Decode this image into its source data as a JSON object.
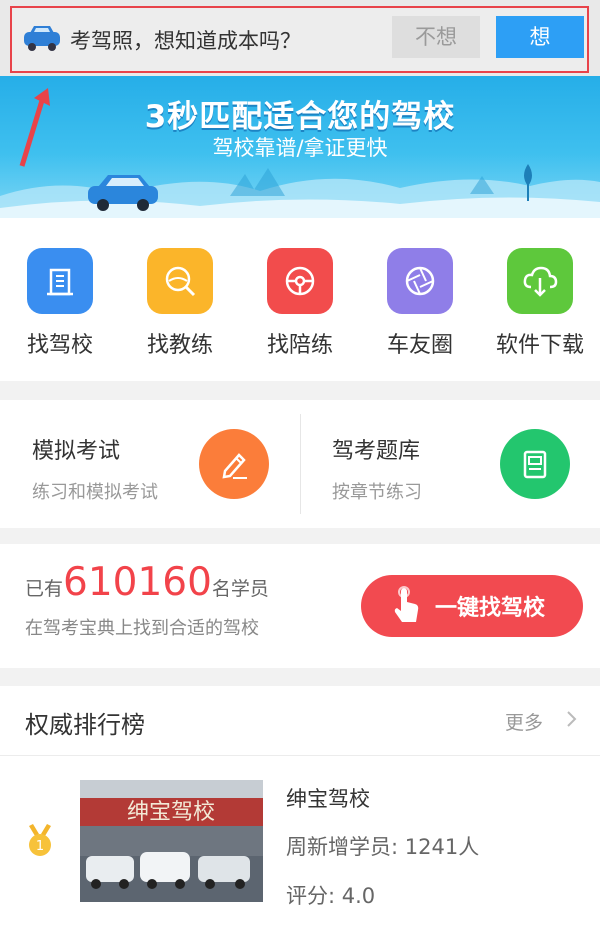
{
  "prompt": {
    "text": "考驾照，想知道成本吗？",
    "no_label": "不想",
    "yes_label": "想"
  },
  "banner": {
    "title": "3秒匹配适合您的驾校",
    "subtitle": "驾校靠谱/拿证更快"
  },
  "nav": [
    {
      "label": "找驾校",
      "icon": "building-icon",
      "color": "#3a8ef0"
    },
    {
      "label": "找教练",
      "icon": "steering-search-icon",
      "color": "#fbb52a"
    },
    {
      "label": "找陪练",
      "icon": "steering-wheel-icon",
      "color": "#f24c4c"
    },
    {
      "label": "车友圈",
      "icon": "aperture-icon",
      "color": "#8f7ee8"
    },
    {
      "label": "软件下载",
      "icon": "cloud-download-icon",
      "color": "#5ec83c"
    }
  ],
  "practice": [
    {
      "title": "模拟考试",
      "desc": "练习和模拟考试",
      "color": "#fb7d3a"
    },
    {
      "title": "驾考题库",
      "desc": "按章节练习",
      "color": "#23c66e"
    }
  ],
  "students": {
    "prefix": "已有",
    "count": "610160",
    "suffix": "名学员",
    "sub": "在驾考宝典上找到合适的驾校",
    "button_label": "一键找驾校"
  },
  "ranking": {
    "title": "权威排行榜",
    "more": "更多",
    "item": {
      "rank": "1",
      "sign_text": "绅宝驾校",
      "name": "绅宝驾校",
      "new_students": "周新增学员: 1241人",
      "score": "评分: 4.0"
    }
  },
  "colors": {
    "accent_blue": "#2d9ff5",
    "accent_red": "#f24a50",
    "banner_blue": "#26aee8"
  }
}
